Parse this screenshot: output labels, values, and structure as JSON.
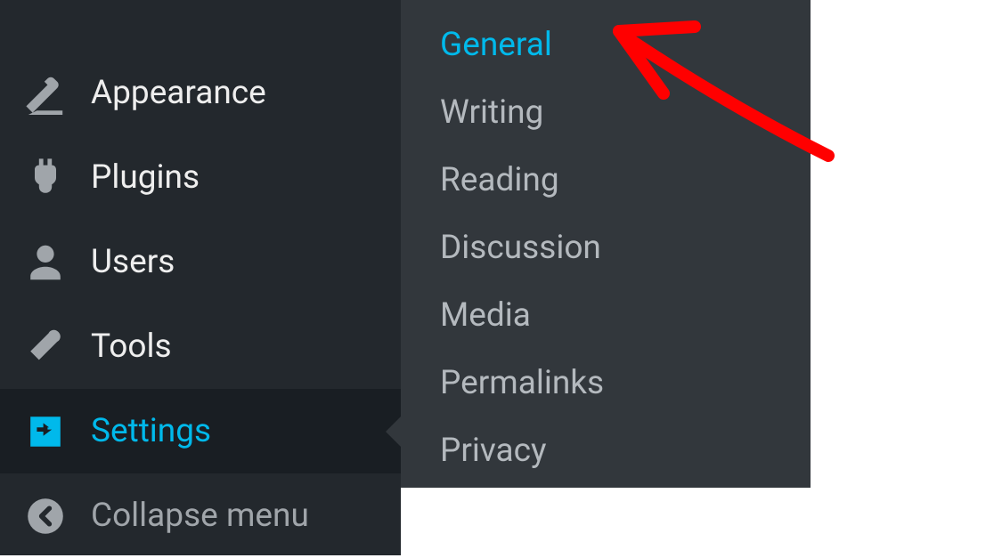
{
  "sidebar": {
    "items": [
      {
        "label": "Appearance",
        "icon": "appearance-icon",
        "active": false
      },
      {
        "label": "Plugins",
        "icon": "plugins-icon",
        "active": false
      },
      {
        "label": "Users",
        "icon": "users-icon",
        "active": false
      },
      {
        "label": "Tools",
        "icon": "tools-icon",
        "active": false
      },
      {
        "label": "Settings",
        "icon": "settings-icon",
        "active": true
      }
    ],
    "collapse_label": "Collapse menu"
  },
  "submenu": {
    "items": [
      {
        "label": "General",
        "active": true
      },
      {
        "label": "Writing",
        "active": false
      },
      {
        "label": "Reading",
        "active": false
      },
      {
        "label": "Discussion",
        "active": false
      },
      {
        "label": "Media",
        "active": false
      },
      {
        "label": "Permalinks",
        "active": false
      },
      {
        "label": "Privacy",
        "active": false
      }
    ]
  },
  "annotation": {
    "color": "#ff0000",
    "type": "arrow-pointing-to-general"
  }
}
